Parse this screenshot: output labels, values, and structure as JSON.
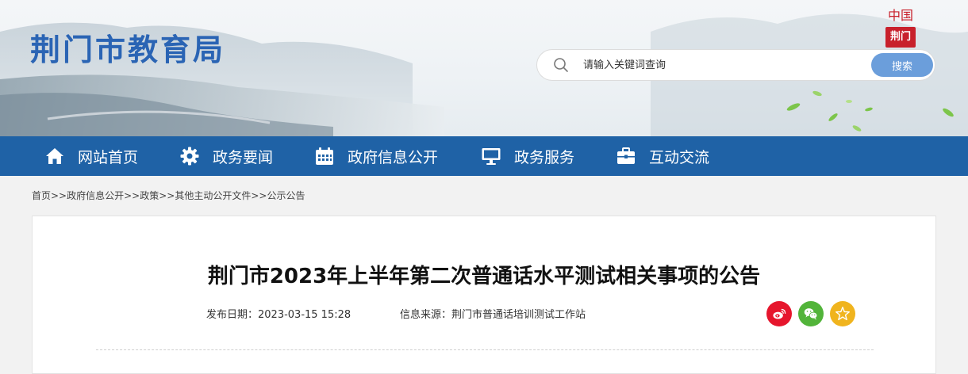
{
  "header": {
    "site_title": "荆门市教育局",
    "search_placeholder": "请输入关键词查询",
    "search_button": "搜索",
    "seal_top": "中国",
    "seal_stamp": "荆门"
  },
  "nav": {
    "items": [
      {
        "label": "网站首页",
        "icon": "home-icon"
      },
      {
        "label": "政务要闻",
        "icon": "gear-icon"
      },
      {
        "label": "政府信息公开",
        "icon": "calendar-icon"
      },
      {
        "label": "政务服务",
        "icon": "monitor-icon"
      },
      {
        "label": "互动交流",
        "icon": "briefcase-icon"
      }
    ]
  },
  "breadcrumb": "首页>>政府信息公开>>政策>>其他主动公开文件>>公示公告",
  "article": {
    "title": "荆门市2023年上半年第二次普通话水平测试相关事项的公告",
    "publish_date": "发布日期：2023-03-15 15:28",
    "source": "信息来源：荆门市普通话培训测试工作站"
  },
  "share": {
    "icons": [
      "weibo-icon",
      "wechat-icon",
      "favorite-star-icon"
    ],
    "colors": {
      "weibo": "#e6162d",
      "wechat": "#52b43a",
      "favorite": "#f0b41e"
    }
  },
  "colors": {
    "nav_bg": "#1f62a6",
    "title_blue": "#2a64b4",
    "search_button": "#6b9edb"
  }
}
